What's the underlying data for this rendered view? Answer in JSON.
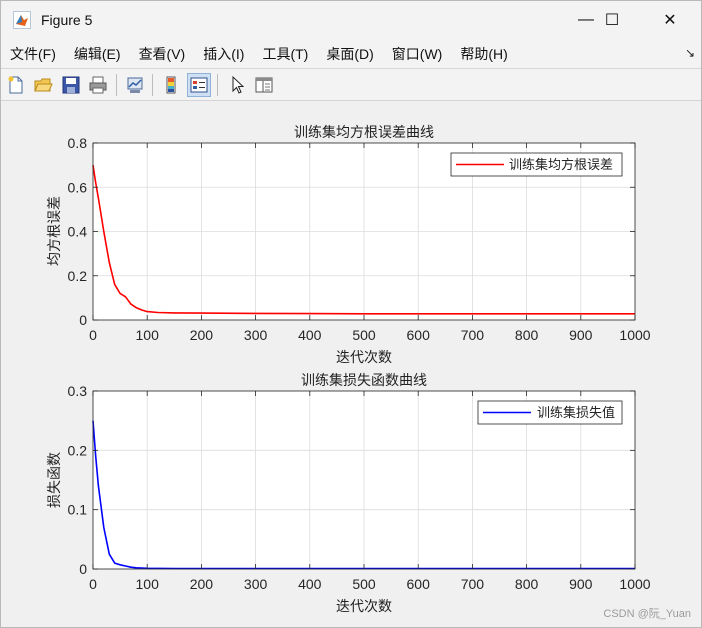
{
  "window": {
    "title": "Figure 5",
    "controls": {
      "minimize": "—",
      "maximize": "☐",
      "close": "✕"
    }
  },
  "menu": {
    "items": [
      "文件(F)",
      "编辑(E)",
      "查看(V)",
      "插入(I)",
      "工具(T)",
      "桌面(D)",
      "窗口(W)",
      "帮助(H)"
    ],
    "corner_glyph": "↘"
  },
  "toolbar": {
    "buttons": [
      {
        "name": "new-figure-icon"
      },
      {
        "name": "open-file-icon"
      },
      {
        "name": "save-icon"
      },
      {
        "name": "print-icon"
      },
      {
        "name": "link-plot-icon"
      },
      {
        "name": "colorbar-icon"
      },
      {
        "name": "legend-icon",
        "pressed": true
      },
      {
        "name": "pointer-icon"
      },
      {
        "name": "property-inspector-icon"
      }
    ]
  },
  "chart_data": [
    {
      "type": "line",
      "title": "训练集均方根误差曲线",
      "xlabel": "迭代次数",
      "ylabel": "均方根误差",
      "xlim": [
        0,
        1000
      ],
      "ylim": [
        0,
        0.8
      ],
      "xticks": [
        "0",
        "100",
        "200",
        "300",
        "400",
        "500",
        "600",
        "700",
        "800",
        "900",
        "1000"
      ],
      "yticks": [
        "0",
        "0.2",
        "0.4",
        "0.6",
        "0.8"
      ],
      "grid": true,
      "legend_position": "top-right",
      "series": [
        {
          "name": "训练集均方根误差",
          "color": "#ff0000",
          "x": [
            0,
            5,
            10,
            20,
            30,
            40,
            50,
            60,
            70,
            80,
            90,
            100,
            120,
            150,
            200,
            300,
            400,
            500,
            600,
            700,
            800,
            900,
            1000
          ],
          "y": [
            0.7,
            0.62,
            0.55,
            0.4,
            0.26,
            0.16,
            0.12,
            0.105,
            0.072,
            0.055,
            0.045,
            0.038,
            0.034,
            0.032,
            0.031,
            0.03,
            0.029,
            0.028,
            0.028,
            0.028,
            0.028,
            0.028,
            0.028
          ]
        }
      ]
    },
    {
      "type": "line",
      "title": "训练集损失函数曲线",
      "xlabel": "迭代次数",
      "ylabel": "损失函数",
      "xlim": [
        0,
        1000
      ],
      "ylim": [
        0,
        0.3
      ],
      "xticks": [
        "0",
        "100",
        "200",
        "300",
        "400",
        "500",
        "600",
        "700",
        "800",
        "900",
        "1000"
      ],
      "yticks": [
        "0",
        "0.1",
        "0.2",
        "0.3"
      ],
      "grid": true,
      "legend_position": "top-right",
      "series": [
        {
          "name": "训练集损失值",
          "color": "#0000ff",
          "x": [
            0,
            5,
            10,
            20,
            30,
            40,
            50,
            60,
            70,
            80,
            100,
            150,
            200,
            300,
            500,
            1000
          ],
          "y": [
            0.25,
            0.19,
            0.14,
            0.07,
            0.025,
            0.01,
            0.007,
            0.005,
            0.003,
            0.002,
            0.0012,
            0.0008,
            0.0008,
            0.0008,
            0.0008,
            0.0008
          ]
        }
      ]
    }
  ],
  "watermark": "CSDN @阮_Yuan"
}
